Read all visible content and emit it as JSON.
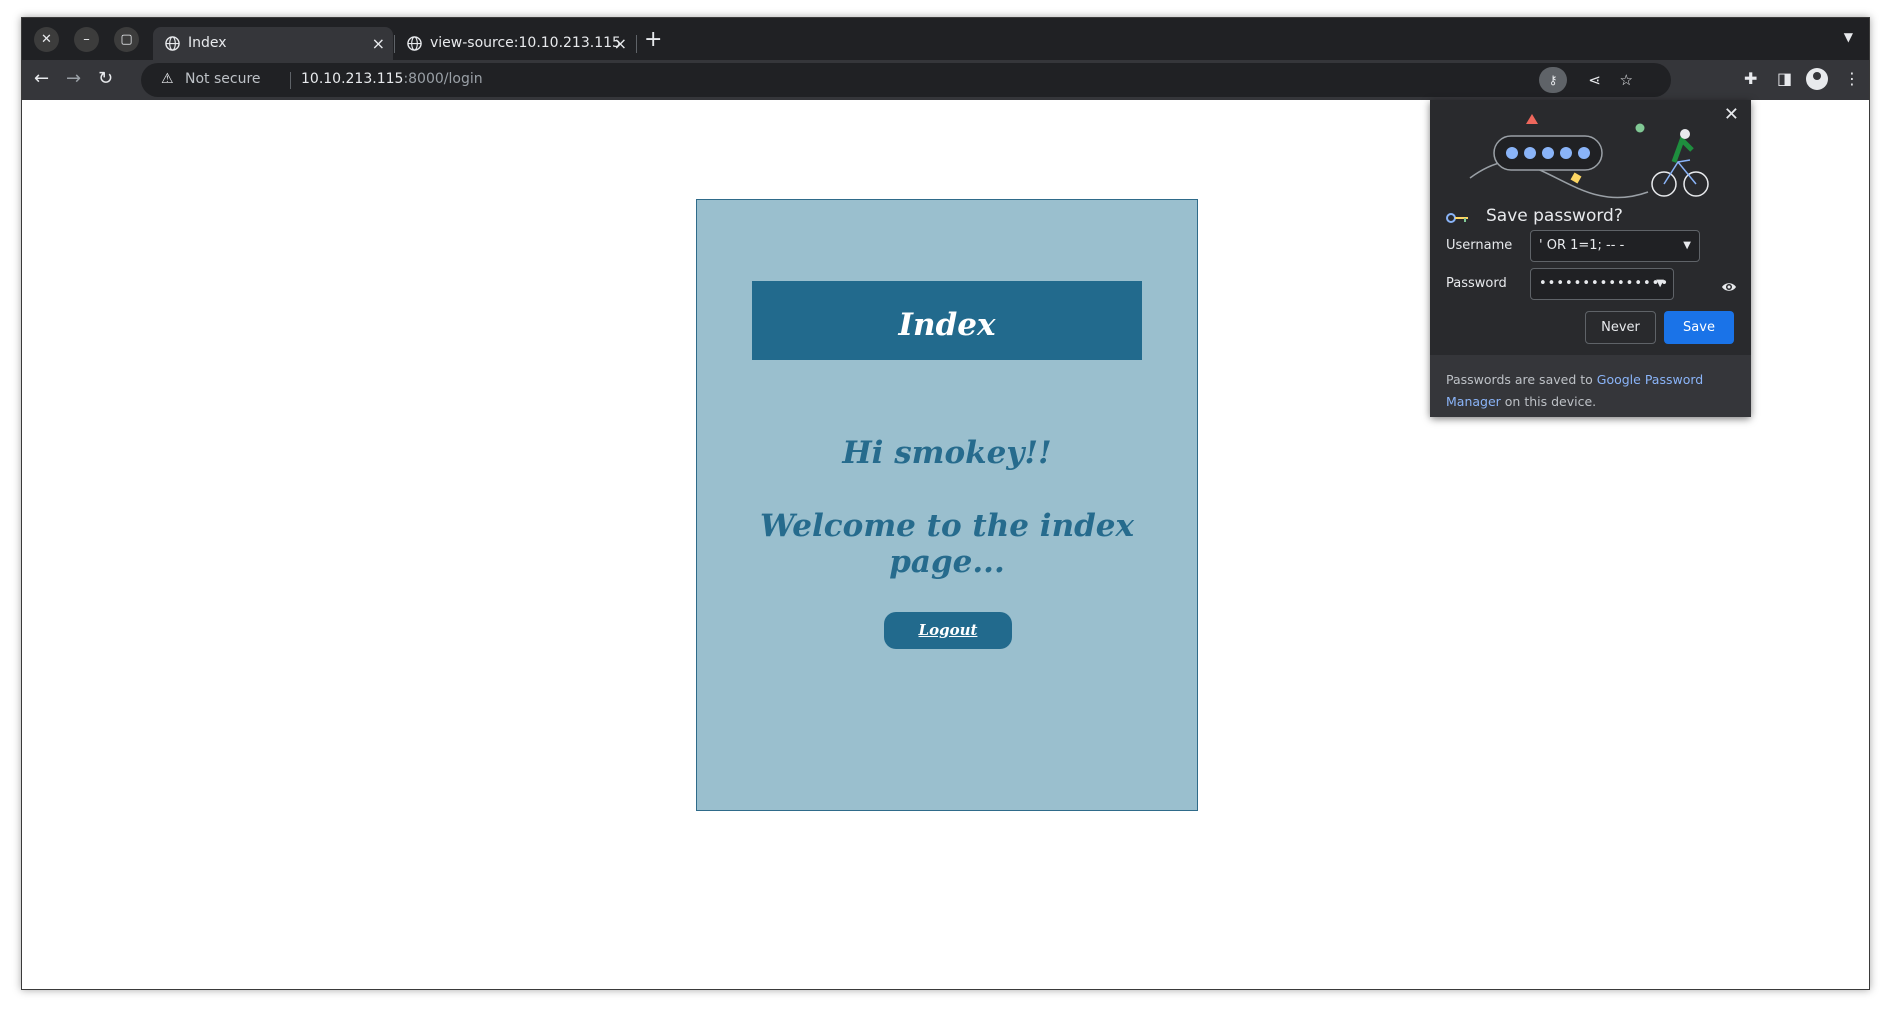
{
  "browser": {
    "window_controls": {
      "close": "✕",
      "minimize": "–",
      "maximize": "▢"
    },
    "tabs": [
      {
        "title": "Index",
        "active": true
      },
      {
        "title": "view-source:10.10.213.115",
        "active": false
      }
    ],
    "new_tab": "+",
    "address": {
      "security_label": "Not secure",
      "host": "10.10.213.115",
      "path": ":8000/login"
    }
  },
  "page": {
    "header_title": "Index",
    "greeting": "Hi smokey!!",
    "welcome": "Welcome to the index page...",
    "logout_label": "Logout",
    "colors": {
      "card_bg": "#9abfce",
      "header_bg": "#226a8d",
      "text": "#266b8d"
    }
  },
  "save_password": {
    "title": "Save password?",
    "username_label": "Username",
    "username_value": "' OR 1=1; -- -",
    "password_label": "Password",
    "password_value": "•••••••••••••••",
    "never_label": "Never",
    "save_label": "Save",
    "footer_pre": "Passwords are saved to ",
    "footer_link": "Google Password Manager",
    "footer_post": " on this device.",
    "accent": "#1a73e8"
  }
}
